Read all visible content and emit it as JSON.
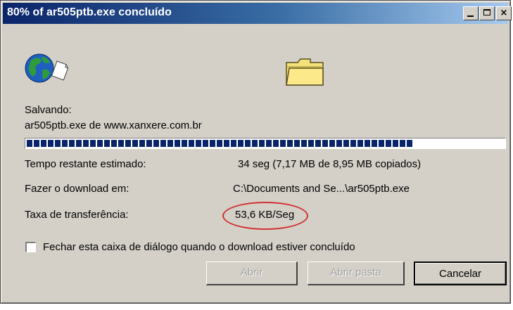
{
  "window": {
    "title": "80% of ar505ptb.exe concluído",
    "minimize_glyph": "_",
    "maximize_glyph": "□",
    "close_glyph": "×"
  },
  "status": {
    "saving_label": "Salvando:",
    "source": "ar505ptb.exe de www.xanxere.com.br"
  },
  "progress": {
    "percent": 80
  },
  "details": {
    "time_label": "Tempo restante estimado:",
    "time_value": "34 seg (7,17 MB de 8,95 MB copiados)",
    "download_to_label": "Fazer o download em:",
    "download_to_value": "C:\\Documents and Se...\\ar505ptb.exe",
    "rate_label": "Taxa de transferência:",
    "rate_value": "53,6 KB/Seg"
  },
  "options": {
    "close_when_done_label": "Fechar esta caixa de diálogo quando o download estiver concluído",
    "close_when_done_checked": false
  },
  "buttons": {
    "open": "Abrir",
    "open_folder": "Abrir pasta",
    "cancel": "Cancelar"
  },
  "colors": {
    "title_start": "#0a246a",
    "title_end": "#a6caf0",
    "progress": "#0a246a",
    "highlight_oval": "#d03030",
    "dialog_bg": "#d4d0c8"
  },
  "icons": {
    "animation": "globe-to-document-icon",
    "destination": "folder-icon"
  }
}
